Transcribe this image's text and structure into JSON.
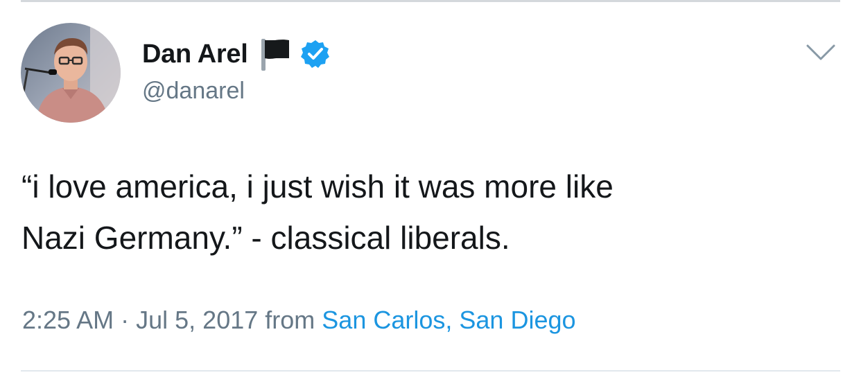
{
  "author": {
    "display_name": "Dan Arel",
    "handle": "@danarel",
    "verified": true,
    "verified_color": "#1da1f2",
    "badge_icons": [
      "black-flag-icon",
      "verified-badge-icon"
    ],
    "avatar_icon": "avatar"
  },
  "header": {
    "menu_icon": "chevron-down-icon"
  },
  "tweet": {
    "text_lines": [
      "“i love america, i just wish it was more like",
      "Nazi Germany.” - classical liberals."
    ]
  },
  "meta": {
    "time": "2:25 AM",
    "separator": "·",
    "date": "Jul 5, 2017",
    "from_label": "from",
    "location": "San Carlos, San Diego",
    "link_color": "#1b95e0"
  }
}
